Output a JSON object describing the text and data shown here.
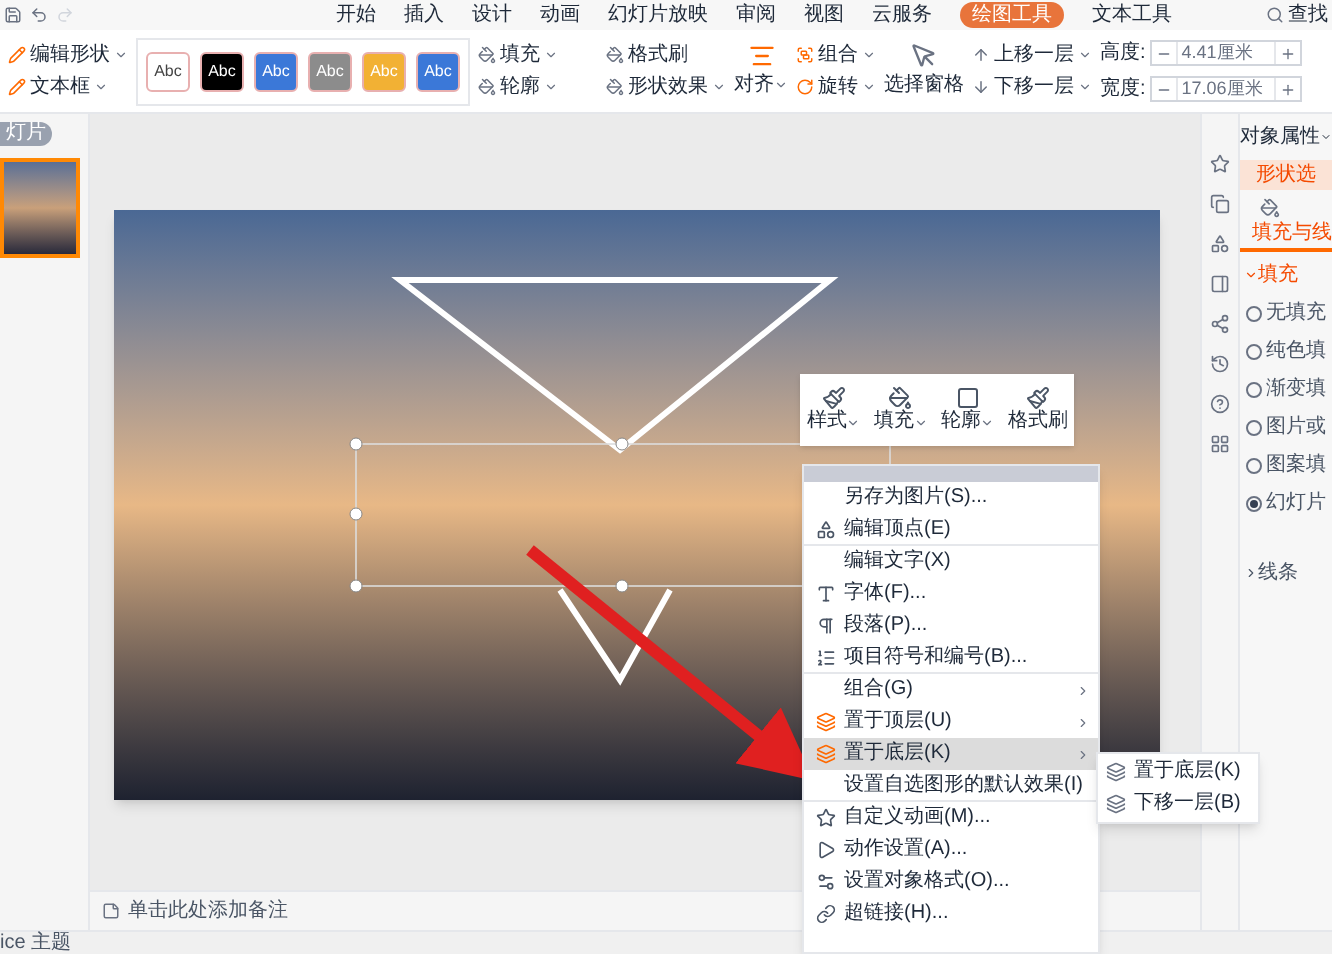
{
  "menu_tabs": [
    {
      "label": "开始",
      "selected": false
    },
    {
      "label": "插入",
      "selected": false
    },
    {
      "label": "设计",
      "selected": false
    },
    {
      "label": "动画",
      "selected": false
    },
    {
      "label": "幻灯片放映",
      "selected": false
    },
    {
      "label": "审阅",
      "selected": false
    },
    {
      "label": "视图",
      "selected": false
    },
    {
      "label": "云服务",
      "selected": false
    },
    {
      "label": "绘图工具",
      "selected": true
    },
    {
      "label": "文本工具",
      "selected": false
    }
  ],
  "search": {
    "label": "查找"
  },
  "ribbon": {
    "shape_tools": [
      {
        "label": "编辑形状",
        "dropdown": true
      },
      {
        "label": "文本框",
        "dropdown": true
      }
    ],
    "style_gallery": [
      {
        "label": "Abc",
        "color": "#ffffff"
      },
      {
        "label": "Abc",
        "color": "#000000"
      },
      {
        "label": "Abc",
        "color": "#3b78d8"
      },
      {
        "label": "Abc",
        "color": "#8c8c8c"
      },
      {
        "label": "Abc",
        "color": "#f2b134"
      },
      {
        "label": "Abc",
        "color": "#3b78d8"
      }
    ],
    "format_tools": [
      {
        "label": "填充",
        "dropdown": true
      },
      {
        "label": "格式刷",
        "dropdown": false
      },
      {
        "label": "轮廓",
        "dropdown": true
      },
      {
        "label": "形状效果",
        "dropdown": true
      }
    ],
    "align": {
      "label": "对齐",
      "dropdown": true
    },
    "arrange_tools": [
      {
        "label": "组合",
        "dropdown": true
      },
      {
        "label": "旋转",
        "dropdown": true
      }
    ],
    "selection_pane": {
      "label": "选择窗格"
    },
    "layer_tools": [
      {
        "label": "上移一层",
        "dropdown": true
      },
      {
        "label": "下移一层",
        "dropdown": true
      }
    ],
    "size_fields": [
      {
        "label": "高度:",
        "value": "4.41厘米"
      },
      {
        "label": "宽度:",
        "value": "17.06厘米"
      }
    ]
  },
  "slides_panel": {
    "label": "灯片"
  },
  "notes": {
    "placeholder": "单击此处添加备注"
  },
  "floating_toolbar": [
    {
      "label": "样式",
      "dropdown": true
    },
    {
      "label": "填充",
      "dropdown": true
    },
    {
      "label": "轮廓",
      "dropdown": true
    },
    {
      "label": "格式刷",
      "dropdown": false
    }
  ],
  "context_menu": [
    {
      "label": "另存为图片(S)...",
      "submenu": false,
      "highlighted": false,
      "separator_after": false
    },
    {
      "label": "编辑顶点(E)",
      "submenu": false,
      "highlighted": false,
      "separator_after": true
    },
    {
      "label": "编辑文字(X)",
      "submenu": false,
      "highlighted": false,
      "separator_after": false
    },
    {
      "label": "字体(F)...",
      "submenu": false,
      "highlighted": false,
      "separator_after": false
    },
    {
      "label": "段落(P)...",
      "submenu": false,
      "highlighted": false,
      "separator_after": false
    },
    {
      "label": "项目符号和编号(B)...",
      "submenu": false,
      "highlighted": false,
      "separator_after": true
    },
    {
      "label": "组合(G)",
      "submenu": true,
      "highlighted": false,
      "separator_after": false
    },
    {
      "label": "置于顶层(U)",
      "submenu": true,
      "highlighted": false,
      "separator_after": false
    },
    {
      "label": "置于底层(K)",
      "submenu": true,
      "highlighted": true,
      "separator_after": false
    },
    {
      "label": "设置自选图形的默认效果(I)",
      "submenu": false,
      "highlighted": false,
      "separator_after": true
    },
    {
      "label": "自定义动画(M)...",
      "submenu": false,
      "highlighted": false,
      "separator_after": false
    },
    {
      "label": "动作设置(A)...",
      "submenu": false,
      "highlighted": false,
      "separator_after": false
    },
    {
      "label": "设置对象格式(O)...",
      "submenu": false,
      "highlighted": false,
      "separator_after": false
    },
    {
      "label": "超链接(H)...",
      "submenu": false,
      "highlighted": false,
      "separator_after": false
    }
  ],
  "submenu": [
    {
      "label": "置于底层(K)"
    },
    {
      "label": "下移一层(B)"
    }
  ],
  "properties_panel": {
    "title": "对象属性",
    "tab": {
      "label": "形状选",
      "selected": true
    },
    "subtab": {
      "label": "填充与线",
      "selected": true
    },
    "fill": {
      "label": "填充",
      "expanded": true,
      "options": [
        {
          "label": "无填充",
          "selected": false
        },
        {
          "label": "纯色填",
          "selected": false
        },
        {
          "label": "渐变填",
          "selected": false
        },
        {
          "label": "图片或",
          "selected": false
        },
        {
          "label": "图案填",
          "selected": false
        },
        {
          "label": "幻灯片",
          "selected": true
        }
      ]
    },
    "line": {
      "label": "线条",
      "expanded": false
    }
  },
  "status_bar": {
    "theme": "ice 主题"
  }
}
